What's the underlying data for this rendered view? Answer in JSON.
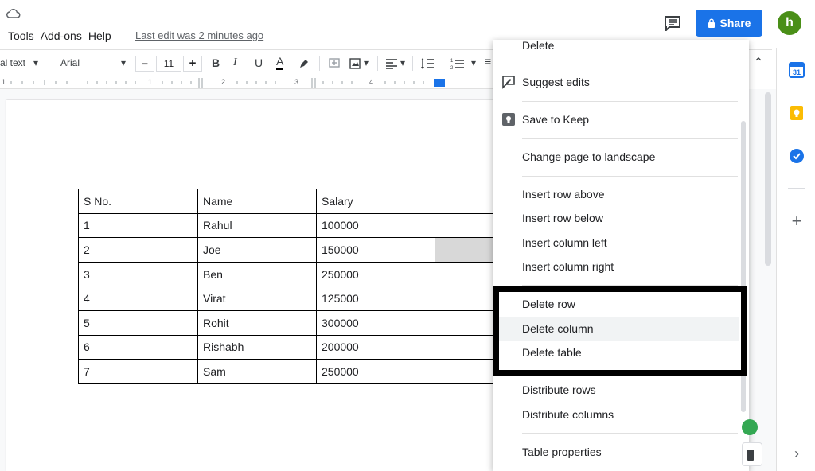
{
  "menubar": {
    "items": [
      "Tools",
      "Add-ons",
      "Help"
    ],
    "last_edit": "Last edit was 2 minutes ago"
  },
  "header": {
    "share_label": "Share",
    "avatar_letter": "h"
  },
  "toolbar": {
    "style": "al text",
    "font": "Arial",
    "font_size": "11",
    "minus": "−",
    "plus": "+",
    "bold": "B",
    "italic": "I",
    "underline": "U",
    "text_color": "A"
  },
  "ruler": {
    "marks": [
      "1",
      "1",
      "2",
      "3",
      "4"
    ]
  },
  "table": {
    "rows": [
      [
        "S No.",
        "Name",
        "Salary",
        ""
      ],
      [
        "1",
        "Rahul",
        "100000",
        ""
      ],
      [
        "2",
        "Joe",
        "150000",
        ""
      ],
      [
        "3",
        "Ben",
        "250000",
        ""
      ],
      [
        "4",
        "Virat",
        "125000",
        ""
      ],
      [
        "5",
        "Rohit",
        "300000",
        ""
      ],
      [
        "6",
        "Rishabh",
        "200000",
        ""
      ],
      [
        "7",
        "Sam",
        "250000",
        ""
      ]
    ]
  },
  "context_menu": {
    "delete": "Delete",
    "suggest_edits": "Suggest edits",
    "save_to_keep": "Save to Keep",
    "change_page": "Change page to landscape",
    "insert_row_above": "Insert row above",
    "insert_row_below": "Insert row below",
    "insert_col_left": "Insert column left",
    "insert_col_right": "Insert column right",
    "delete_row": "Delete row",
    "delete_column": "Delete column",
    "delete_table": "Delete table",
    "distribute_rows": "Distribute rows",
    "distribute_columns": "Distribute columns",
    "table_properties": "Table properties"
  },
  "colors": {
    "share_blue": "#1a73e8",
    "avatar_green": "#4a8f18",
    "calendar_blue": "#1a73e8",
    "keep_yellow": "#fbbc04",
    "tasks_blue": "#1a73e8"
  }
}
